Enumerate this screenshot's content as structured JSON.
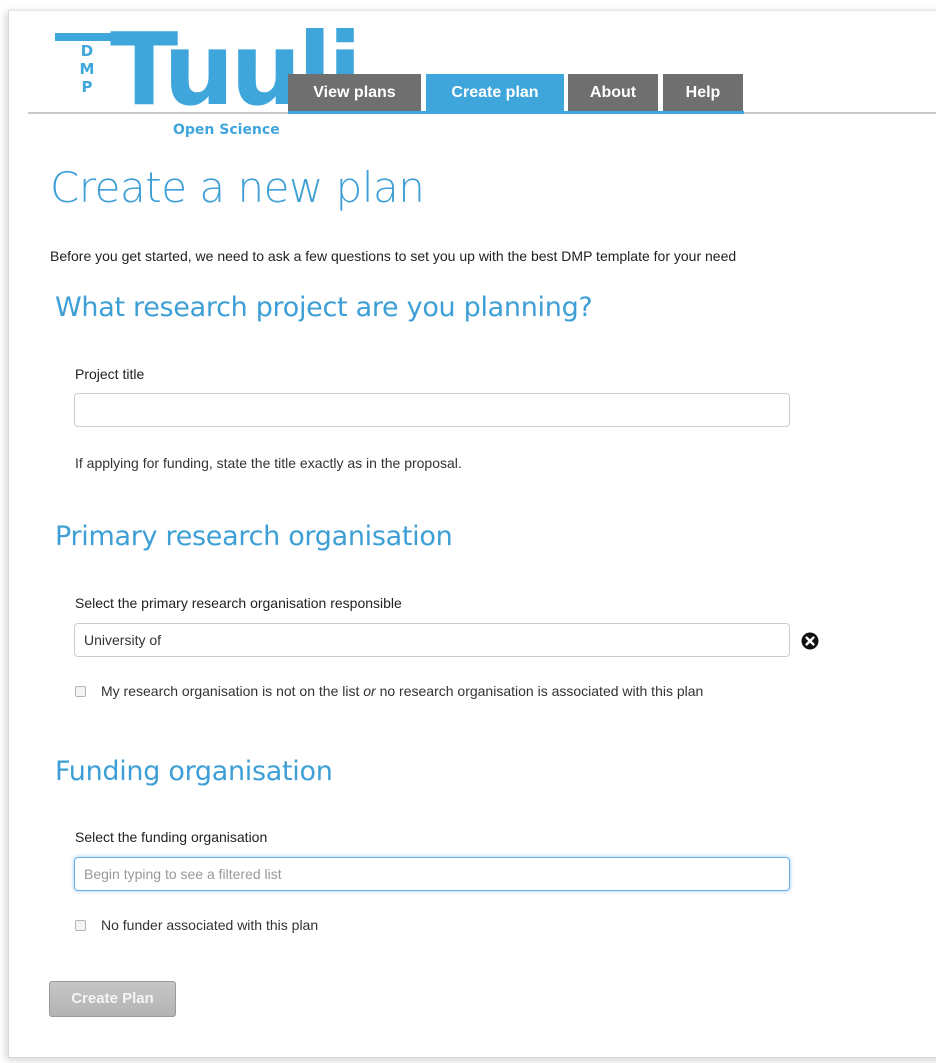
{
  "brand": {
    "dmp_letters": [
      "D",
      "M",
      "P"
    ],
    "wordmark": "Tuuli",
    "subtitle": "Open Science",
    "color": "#3fa6dc"
  },
  "nav": {
    "tabs": [
      {
        "label": "View plans",
        "active": false
      },
      {
        "label": "Create plan",
        "active": true
      },
      {
        "label": "About",
        "active": false
      },
      {
        "label": "Help",
        "active": false
      }
    ]
  },
  "page": {
    "title": "Create a new plan",
    "intro": "Before you get started, we need to ask a few questions to set you up with the best DMP template for your need"
  },
  "project": {
    "heading": "What research project are you planning?",
    "label": "Project title",
    "value": "",
    "help": "If applying for funding, state the title exactly as in the proposal."
  },
  "organisation": {
    "heading": "Primary research organisation",
    "label": "Select the primary research organisation responsible",
    "value": "University of",
    "clear_icon": "times-circle-icon",
    "checkbox_label_part1": "My research organisation is not on the list",
    "checkbox_label_or": "or",
    "checkbox_label_part2": "no research organisation is associated with this plan",
    "checked": false
  },
  "funding": {
    "heading": "Funding organisation",
    "label": "Select the funding organisation",
    "value": "",
    "placeholder": "Begin typing to see a filtered list",
    "checkbox_label": "No funder associated with this plan",
    "checked": false
  },
  "submit": {
    "label": "Create Plan",
    "disabled": true
  }
}
